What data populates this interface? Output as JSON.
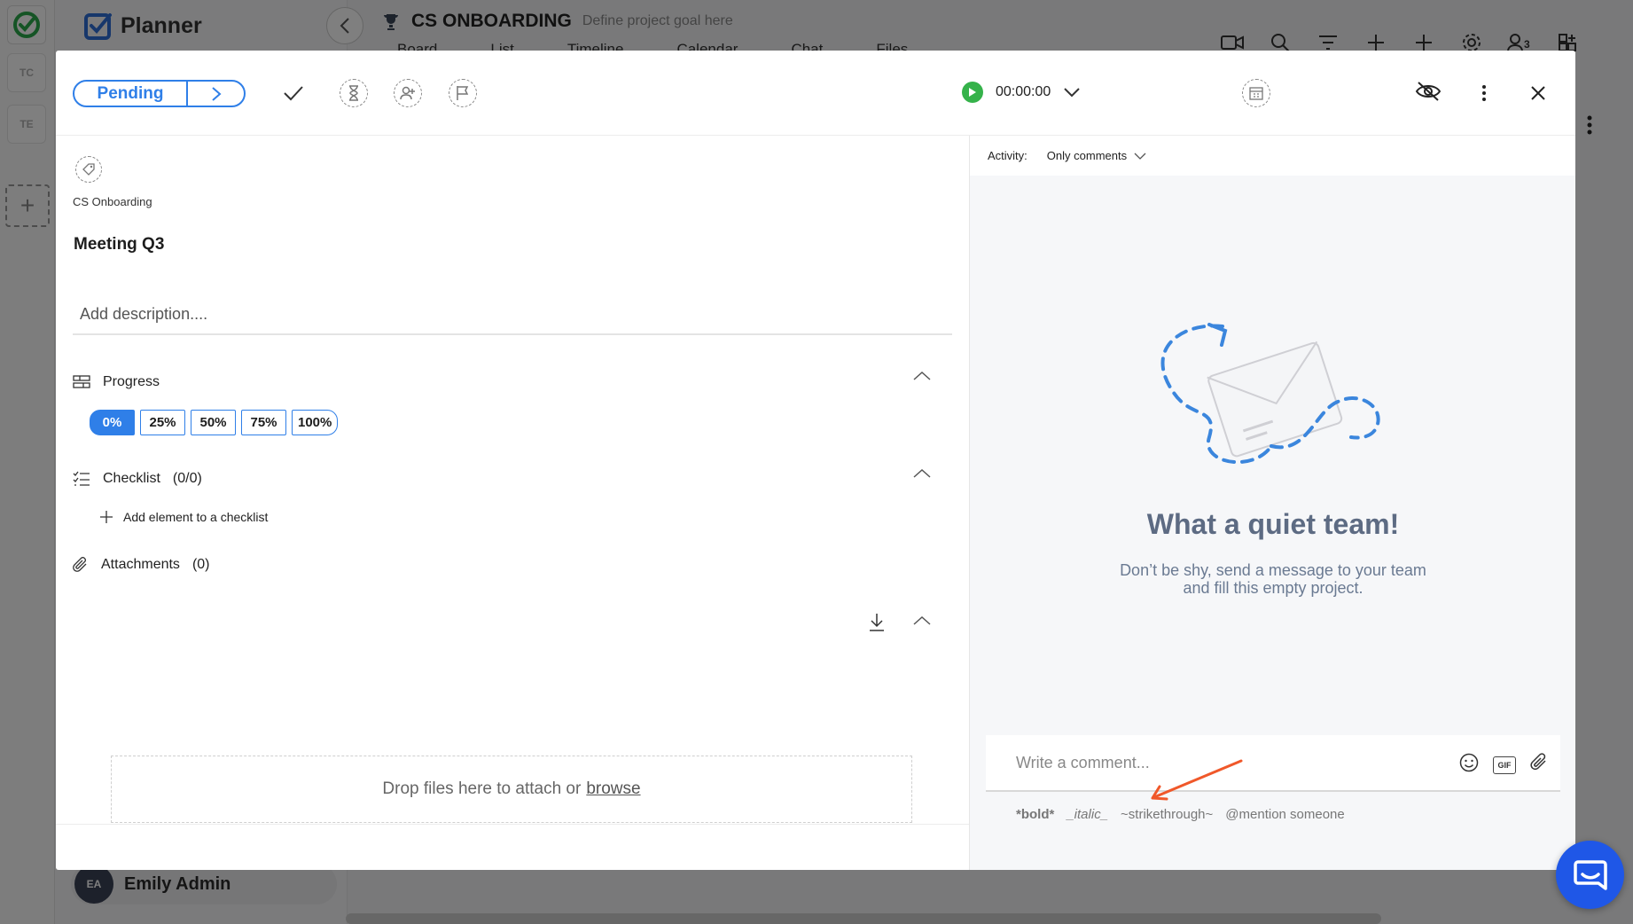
{
  "app": {
    "brand": "Planner"
  },
  "rail": {
    "tiles": [
      "TC",
      "TE"
    ]
  },
  "project": {
    "title": "CS ONBOARDING",
    "goal": "Define project goal here"
  },
  "tabs": [
    "Board",
    "List",
    "Timeline",
    "Calendar",
    "Chat",
    "Files"
  ],
  "user": {
    "initials": "EA",
    "name": "Emily Admin"
  },
  "task": {
    "status": "Pending",
    "timer": "00:00:00",
    "breadcrumb": "CS Onboarding",
    "title": "Meeting Q3",
    "description_placeholder": "Add description....",
    "progress": {
      "label": "Progress",
      "options": [
        "0%",
        "25%",
        "50%",
        "75%",
        "100%"
      ],
      "selected": "0%"
    },
    "checklist": {
      "label": "Checklist",
      "count": "(0/0)",
      "add_label": "Add element to a checklist"
    },
    "attachments": {
      "label": "Attachments",
      "count": "(0)"
    },
    "dropzone": {
      "text": "Drop files here to attach or",
      "link": "browse"
    }
  },
  "activity": {
    "label": "Activity:",
    "filter": "Only comments",
    "empty_title": "What a quiet team!",
    "empty_line1": "Don’t be shy, send a message to your team",
    "empty_line2": "and fill this empty project."
  },
  "comment": {
    "placeholder": "Write a comment...",
    "hints": [
      "*bold*",
      "_italic_",
      "~strikethrough~",
      "@mention someone"
    ],
    "gif_label": "GIF"
  },
  "colors": {
    "accent": "#2f7fe8",
    "play": "#35b24a",
    "chat_fab": "#1f57e7",
    "annotation_arrow": "#f0582a"
  }
}
